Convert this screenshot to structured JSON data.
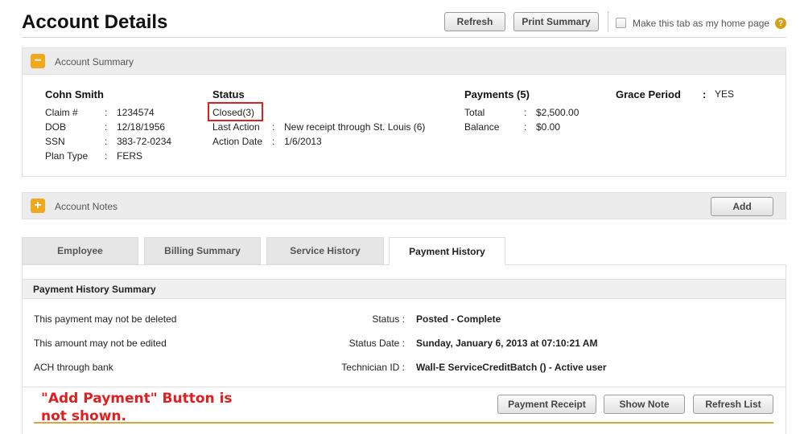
{
  "page": {
    "title": "Account Details",
    "refresh_label": "Refresh",
    "print_label": "Print Summary",
    "home_tab_label": "Make this tab as my home page",
    "help_glyph": "?"
  },
  "account_summary": {
    "title": "Account Summary",
    "toggle_glyph": "−",
    "name": "Cohn Smith",
    "fields": [
      {
        "label": "Claim #",
        "sep": ":",
        "value": "1234574"
      },
      {
        "label": "DOB",
        "sep": ":",
        "value": "12/18/1956"
      },
      {
        "label": "SSN",
        "sep": ":",
        "value": "383-72-0234"
      },
      {
        "label": "Plan Type",
        "sep": ":",
        "value": "FERS"
      }
    ],
    "status": {
      "heading": "Status",
      "value": "Closed(3)",
      "last_action_label": "Last Action",
      "last_action_value": "New receipt through St. Louis (6)",
      "action_date_label": "Action Date",
      "action_date_value": "1/6/2013",
      "sep": ":"
    },
    "payments": {
      "heading": "Payments (5)",
      "total_label": "Total",
      "total_value": "$2,500.00",
      "balance_label": "Balance",
      "balance_value": "$0.00",
      "sep": ":"
    },
    "grace": {
      "heading": "Grace Period",
      "sep": ":",
      "value": "YES"
    }
  },
  "account_notes": {
    "title": "Account Notes",
    "toggle_glyph": "+",
    "add_label": "Add"
  },
  "tabs": [
    {
      "label": "Employee",
      "active": false
    },
    {
      "label": "Billing Summary",
      "active": false
    },
    {
      "label": "Service History",
      "active": false
    },
    {
      "label": "Payment History",
      "active": true
    }
  ],
  "payment_history": {
    "section_title": "Payment History Summary",
    "left_notes": [
      "This payment may not be deleted",
      "This amount may not be edited",
      "ACH through bank"
    ],
    "status_label": "Status :",
    "status_value": "Posted - Complete",
    "status_date_label": "Status Date :",
    "status_date_value": "Sunday, January 6, 2013 at 07:10:21 AM",
    "technician_label": "Technician ID :",
    "technician_value": "Wall-E ServiceCreditBatch () - Active user",
    "buttons": {
      "receipt": "Payment Receipt",
      "show_note": "Show Note",
      "refresh_list": "Refresh List"
    },
    "annotation_line1": "\"Add Payment\" Button is",
    "annotation_line2": "not shown."
  },
  "colors": {
    "accent": "#f0a81c",
    "highlight_box": "#e02020",
    "annotation": "#e02020"
  }
}
